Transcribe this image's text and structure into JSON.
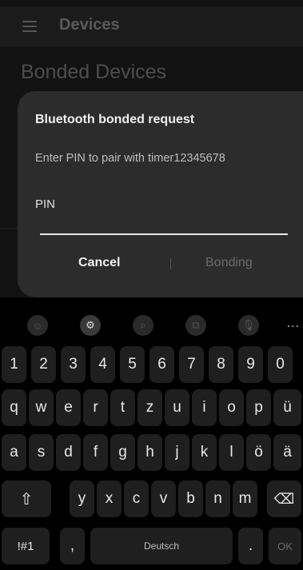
{
  "appbar": {
    "title": "Devices"
  },
  "section_title": "Bonded Devices",
  "dialog": {
    "title": "Bluetooth bonded request",
    "message": "Enter PIN to pair with timer12345678",
    "pin_label": "PIN",
    "pin_value": "",
    "cancel_label": "Cancel",
    "bonding_label": "Bonding"
  },
  "keyboard": {
    "more": "...",
    "row_numbers": [
      "1",
      "2",
      "3",
      "4",
      "5",
      "6",
      "7",
      "8",
      "9",
      "0"
    ],
    "row_top": [
      "q",
      "w",
      "e",
      "r",
      "t",
      "z",
      "u",
      "i",
      "o",
      "p",
      "ü"
    ],
    "row_middle": [
      "a",
      "s",
      "d",
      "f",
      "g",
      "h",
      "j",
      "k",
      "l",
      "ö",
      "ä"
    ],
    "row_bottom": [
      "y",
      "x",
      "c",
      "v",
      "b",
      "n",
      "m"
    ],
    "symbols": "!#1",
    "comma": ",",
    "space": "Deutsch",
    "period": ".",
    "ok": "OK"
  }
}
